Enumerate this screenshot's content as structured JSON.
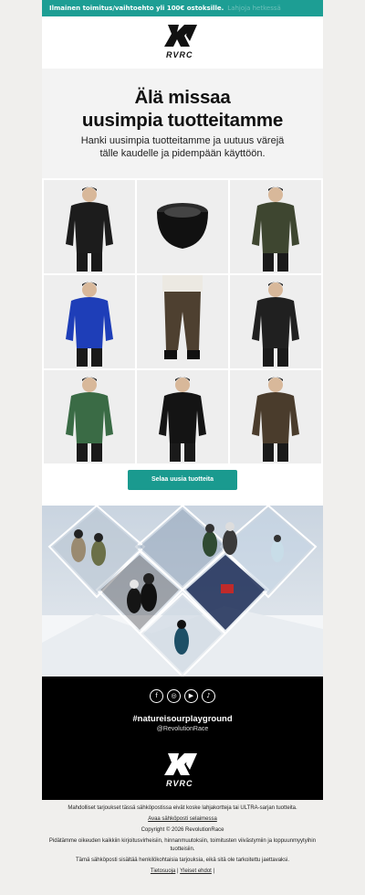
{
  "banner": {
    "text": "Ilmainen toimitus/vaihtoehto yli 100€ ostoksille.",
    "faded_text": "Lahjoja hetkessä"
  },
  "brand": {
    "logo_text": "RVRC"
  },
  "hero": {
    "title_line1": "Älä missaa",
    "title_line2": "uusimpia tuotteitamme",
    "subtitle_line1": "Hanki uusimpia tuotteitamme ja uutuus värejä",
    "subtitle_line2": "tälle kaudelle ja pidempään käyttöön."
  },
  "products": [
    {
      "name": "black-down-jacket",
      "color": "#1c1c1c"
    },
    {
      "name": "black-neck-gaiter",
      "color": "#111111"
    },
    {
      "name": "olive-shell-jacket",
      "color": "#3e4630"
    },
    {
      "name": "blue-shell-jacket",
      "color": "#1e3eb8"
    },
    {
      "name": "brown-trousers",
      "color": "#4e4030"
    },
    {
      "name": "black-hoodie",
      "color": "#202020"
    },
    {
      "name": "green-hoodie",
      "color": "#3a6b45"
    },
    {
      "name": "black-softshell",
      "color": "#141414"
    },
    {
      "name": "brown-shell-jacket",
      "color": "#4a3c2c"
    }
  ],
  "cta": {
    "label": "Selaa uusia tuotteita"
  },
  "footer": {
    "socials": [
      "facebook-icon",
      "instagram-icon",
      "youtube-icon",
      "tiktok-icon"
    ],
    "hashtag": "#natureisourplayground",
    "handle": "@RevolutionRace"
  },
  "legal": {
    "line1": "Mahdolliset tarjoukset tässä sähköpostissa eivät koske lahjakortteja tai ULTRA-sarjan tuotteita.",
    "browser_link": "Avaa sähköposti selaimessa",
    "copyright": "Copyright © 2026 RevolutionRace",
    "line3": "Pidätämme oikeuden kaikkiin kirjoitusvirheisiin, hinnanmuutoksiin, toimitusten viivästymiin ja loppuunmyytyihin tuotteisiin.",
    "line4": "Tämä sähköposti sisältää henkilökohtaisia tarjouksia, eikä sitä ole tarkoitettu jaettavaksi.",
    "privacy_link": "Tietosuoja",
    "separator": "|",
    "terms_link": "Yleiset ehdot",
    "separator2": "|"
  }
}
